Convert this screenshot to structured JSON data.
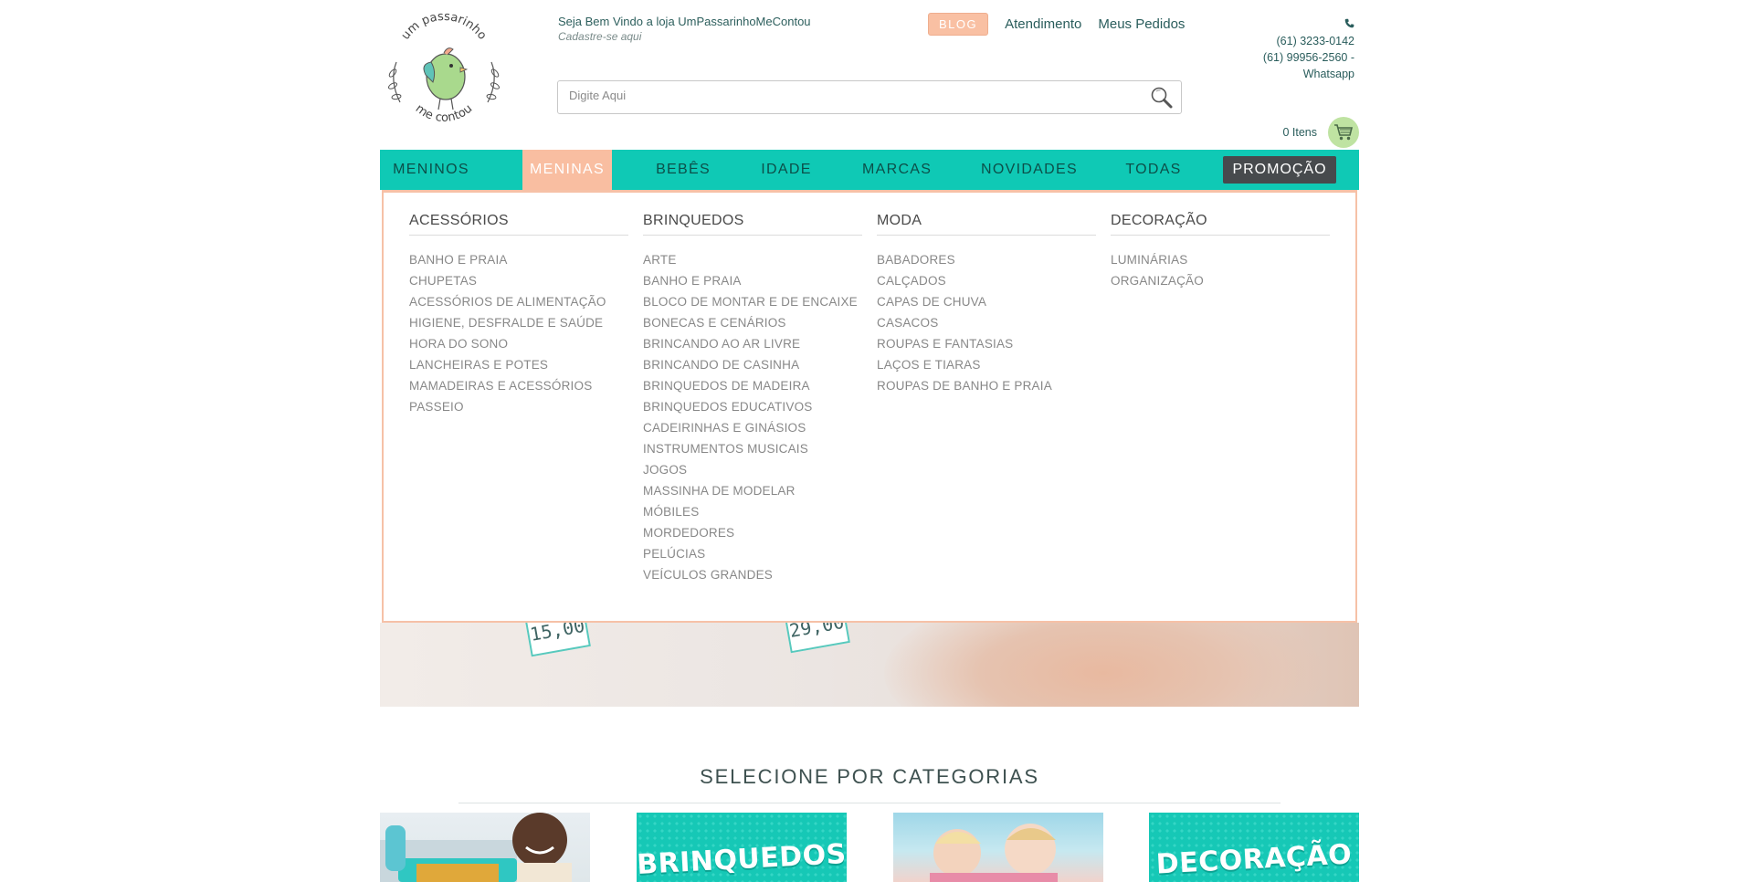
{
  "header": {
    "logo_text_top": "um passarinho",
    "logo_text_bottom": "me contou",
    "welcome": "Seja Bem Vindo a loja UmPassarinhoMeContou",
    "signup": "Cadastre-se aqui",
    "links": {
      "blog": "BLOG",
      "support": "Atendimento",
      "orders": "Meus Pedidos"
    },
    "phones": {
      "line1": "(61) 3233-0142",
      "line2": "(61) 99956-2560 -",
      "line3": "Whatsapp"
    },
    "search": {
      "placeholder": "Digite Aqui"
    },
    "cart": {
      "count_label": "0 Itens"
    }
  },
  "nav": {
    "items": [
      {
        "label": "MENINOS"
      },
      {
        "label": "MENINAS",
        "active": true
      },
      {
        "label": "BEBÊS"
      },
      {
        "label": "IDADE"
      },
      {
        "label": "MARCAS"
      },
      {
        "label": "NOVIDADES"
      },
      {
        "label": "TODAS"
      }
    ],
    "promo": "PROMOÇÃO"
  },
  "mega_menu": {
    "columns": [
      {
        "title": "ACESSÓRIOS",
        "items": [
          "BANHO E PRAIA",
          "CHUPETAS",
          "ACESSÓRIOS DE ALIMENTAÇÃO",
          "HIGIENE, DESFRALDE E SAÚDE",
          "HORA DO SONO",
          "LANCHEIRAS E POTES",
          "MAMADEIRAS E ACESSÓRIOS",
          "PASSEIO"
        ]
      },
      {
        "title": "BRINQUEDOS",
        "items": [
          "ARTE",
          "BANHO E PRAIA",
          "BLOCO DE MONTAR E DE ENCAIXE",
          "BONECAS E CENÁRIOS",
          "BRINCANDO AO AR LIVRE",
          "BRINCANDO DE CASINHA",
          "BRINQUEDOS DE MADEIRA",
          "BRINQUEDOS EDUCATIVOS",
          "CADEIRINHAS E GINÁSIOS",
          "INSTRUMENTOS MUSICAIS",
          "JOGOS",
          "MASSINHA DE MODELAR",
          "MÓBILES",
          "MORDEDORES",
          "PELÚCIAS",
          "VEÍCULOS GRANDES"
        ]
      },
      {
        "title": "MODA",
        "items": [
          "BABADORES",
          "CALÇADOS",
          "CAPAS DE CHUVA",
          "CASACOS",
          "ROUPAS E FANTASIAS",
          "LAÇOS E TIARAS",
          "ROUPAS DE BANHO E PRAIA"
        ]
      },
      {
        "title": "DECORAÇÃO",
        "items": [
          "LUMINÁRIAS",
          "ORGANIZAÇÃO"
        ]
      }
    ]
  },
  "banner": {
    "price_1": "15,00",
    "price_2": "29,00"
  },
  "categories": {
    "title": "SELECIONE POR CATEGORIAS",
    "cards": [
      {
        "label": ""
      },
      {
        "label": "BRINQUEDOS"
      },
      {
        "label": ""
      },
      {
        "label": "DECORAÇÃO"
      }
    ]
  },
  "colors": {
    "nav_bg": "#0fc9b5",
    "accent_peach": "#f9bea1",
    "promo_bg": "#474a4d",
    "text_teal": "#2a5d5c"
  }
}
